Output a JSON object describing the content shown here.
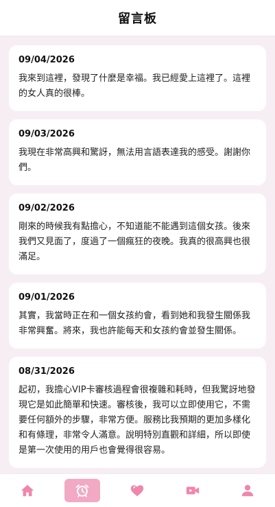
{
  "header": {
    "title": "留言板"
  },
  "messages": [
    {
      "date": "09/04/2026",
      "text": "我來到這裡，發現了什麼是幸福。我已經愛上這裡了。這裡的女人真的很棒。"
    },
    {
      "date": "09/03/2026",
      "text": "我現在非常高興和驚訝，無法用言語表達我的感受。謝謝你們。"
    },
    {
      "date": "09/02/2026",
      "text": "剛來的時候我有點擔心，不知道能不能遇到這個女孩。後來我們又見面了，度過了一個瘋狂的夜晚。我真的很高興也很滿足。"
    },
    {
      "date": "09/01/2026",
      "text": "其實，我當時正在和一個女孩約會，看到她和我發生關係我非常興奮。將來，我也許能每天和女孩約會並發生關係。"
    },
    {
      "date": "08/31/2026",
      "text": "起初，我擔心VIP卡審核過程會很複雜和耗時，但我驚訝地發現它是如此簡單和快速。審核後，我可以立即使用它，不需要任何額外的步驟，非常方便。服務比我預期的更加多樣化和有條理，非常令人滿意。說明特別直觀和詳細，所以即使是第一次使用的用戶也會覺得很容易。"
    }
  ],
  "tabbar": {
    "items": [
      {
        "icon": "home-icon"
      },
      {
        "icon": "alarm-clock-icon",
        "active": true
      },
      {
        "icon": "heart-icon"
      },
      {
        "icon": "video-camera-icon"
      },
      {
        "icon": "user-icon"
      }
    ]
  },
  "colors": {
    "accent": "#f2a9c3",
    "icon": "#ef86ab",
    "background": "#f7eef3"
  }
}
